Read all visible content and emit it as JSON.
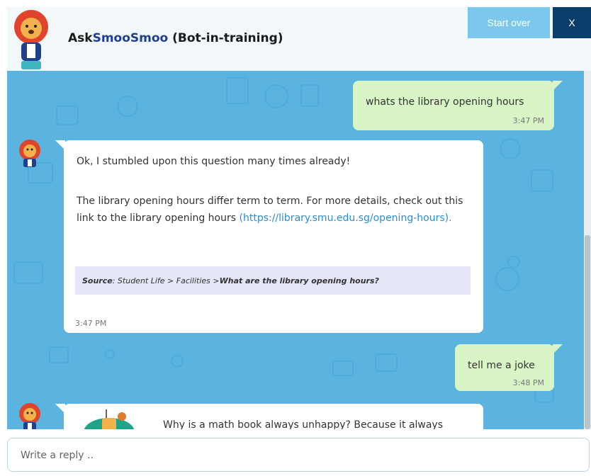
{
  "header": {
    "title_prefix": "Ask",
    "title_brand": "SmooSmoo",
    "title_suffix": " (Bot-in-training)",
    "start_over_label": "Start over",
    "close_label": "X"
  },
  "messages": [
    {
      "from": "user",
      "text": "whats the library opening hours",
      "time": "3:47 PM"
    },
    {
      "from": "bot",
      "line1": "Ok, I stumbled upon this question many times already!",
      "para2": "The library opening hours differ term to term. For more details, check out this link to the library opening hours",
      "link": "(https://library.smu.edu.sg/opening-hours).",
      "source_label": "Source",
      "source_path": ": Student Life > Facilities > ",
      "source_question": "What are the library opening hours?",
      "time": "3:47 PM"
    },
    {
      "from": "user",
      "text": "tell me a joke",
      "time": "3:48 PM"
    },
    {
      "from": "bot",
      "text": "Why is a math book always unhappy? Because it always"
    }
  ],
  "input": {
    "placeholder": "Write a reply .."
  },
  "colors": {
    "chat_bg": "#5ab4df",
    "user_bubble": "#d9f5c6",
    "start_over": "#7cc8ec",
    "close": "#0b3d6b"
  }
}
